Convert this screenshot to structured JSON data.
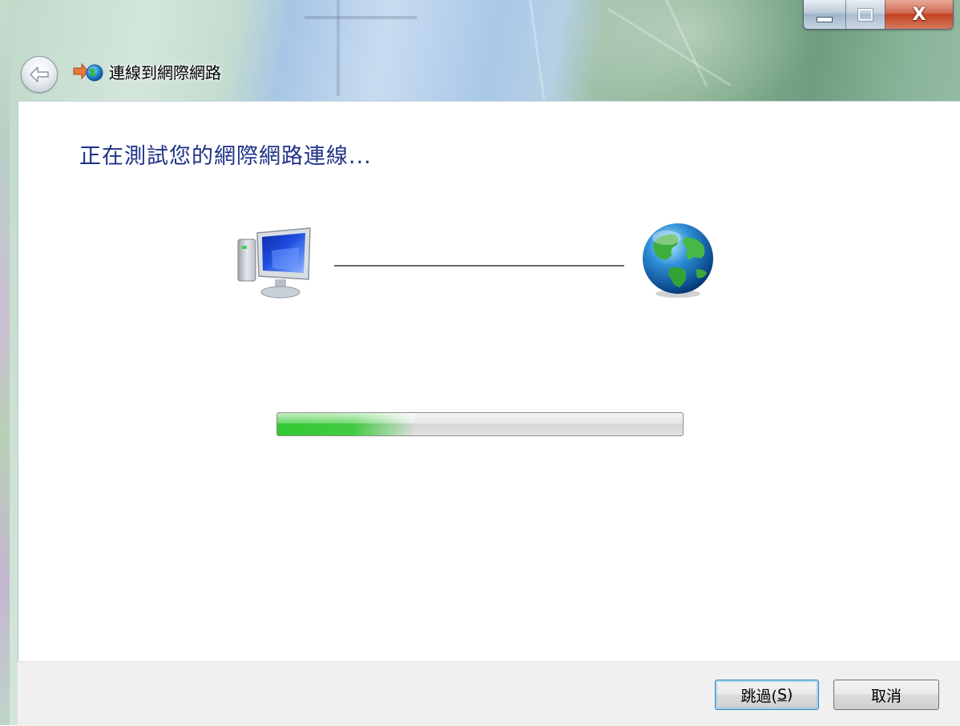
{
  "window": {
    "title": "連線到網際網路",
    "controls": [
      "minimize-icon",
      "maximize-icon",
      "close-icon"
    ],
    "close_glyph": "X"
  },
  "main": {
    "heading": "正在測試您的網際網路連線..."
  },
  "progress": {
    "value": 0.34
  },
  "footer": {
    "skip_label": "跳過(",
    "skip_mnemonic": "S",
    "skip_suffix": ")",
    "cancel_label": "取消"
  },
  "colors": {
    "heading": "#1e3287",
    "progress_fill": "#28c828",
    "close_button": "#c2401f"
  },
  "icons": [
    "back-arrow-icon",
    "network-connection-icon",
    "computer-icon",
    "globe-icon"
  ]
}
